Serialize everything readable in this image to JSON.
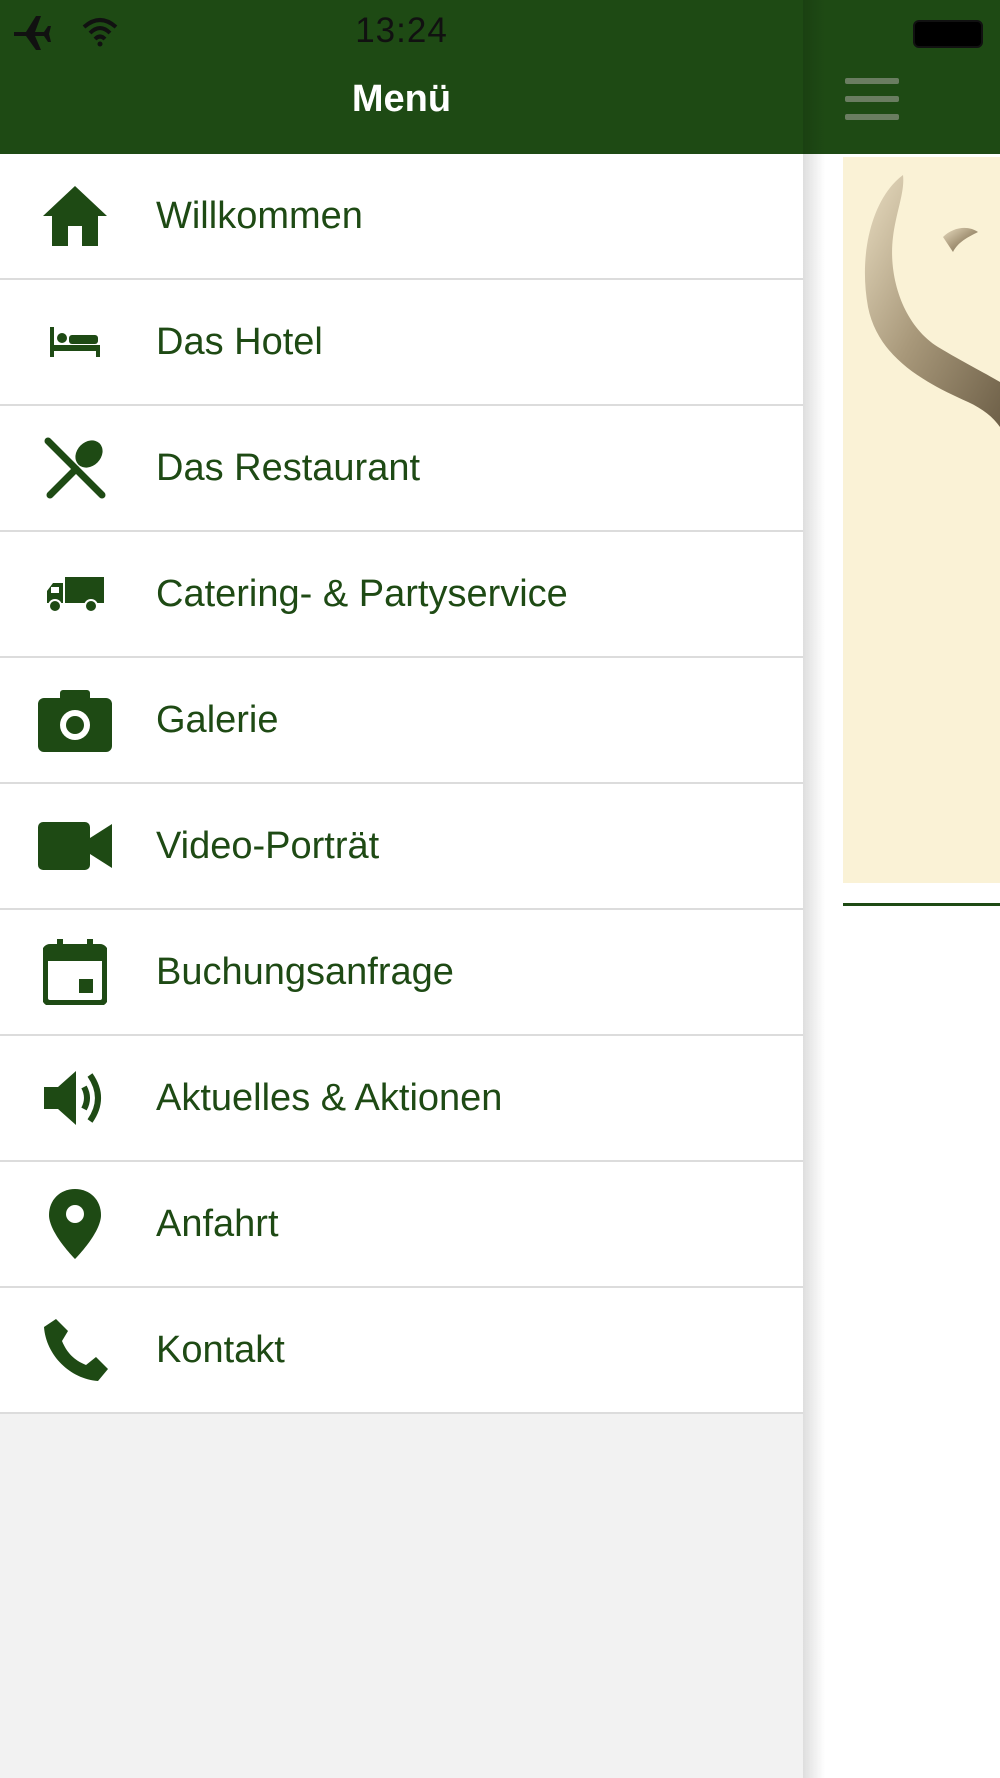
{
  "status_bar": {
    "time": "13:24",
    "airplane_icon": "airplane-icon",
    "wifi_icon": "wifi-icon",
    "battery_icon": "battery-icon"
  },
  "drawer": {
    "title": "Menü",
    "items": [
      {
        "label": "Willkommen",
        "icon": "home-icon"
      },
      {
        "label": "Das Hotel",
        "icon": "bed-icon"
      },
      {
        "label": "Das Restaurant",
        "icon": "cutlery-icon"
      },
      {
        "label": "Catering- & Partyservice",
        "icon": "truck-icon"
      },
      {
        "label": "Galerie",
        "icon": "camera-icon"
      },
      {
        "label": "Video-Porträt",
        "icon": "video-camera-icon"
      },
      {
        "label": "Buchungsanfrage",
        "icon": "calendar-icon"
      },
      {
        "label": "Aktuelles & Aktionen",
        "icon": "speaker-icon"
      },
      {
        "label": "Anfahrt",
        "icon": "map-pin-icon"
      },
      {
        "label": "Kontakt",
        "icon": "phone-icon"
      }
    ]
  },
  "content": {
    "menu_icon": "hamburger-menu-icon",
    "hero_image": "antler-logo-image"
  },
  "colors": {
    "brand_green": "#1e4a14",
    "drawer_background": "#f2f2f2",
    "hero_background": "#faf2d6",
    "divider": "#dcdcdc"
  }
}
